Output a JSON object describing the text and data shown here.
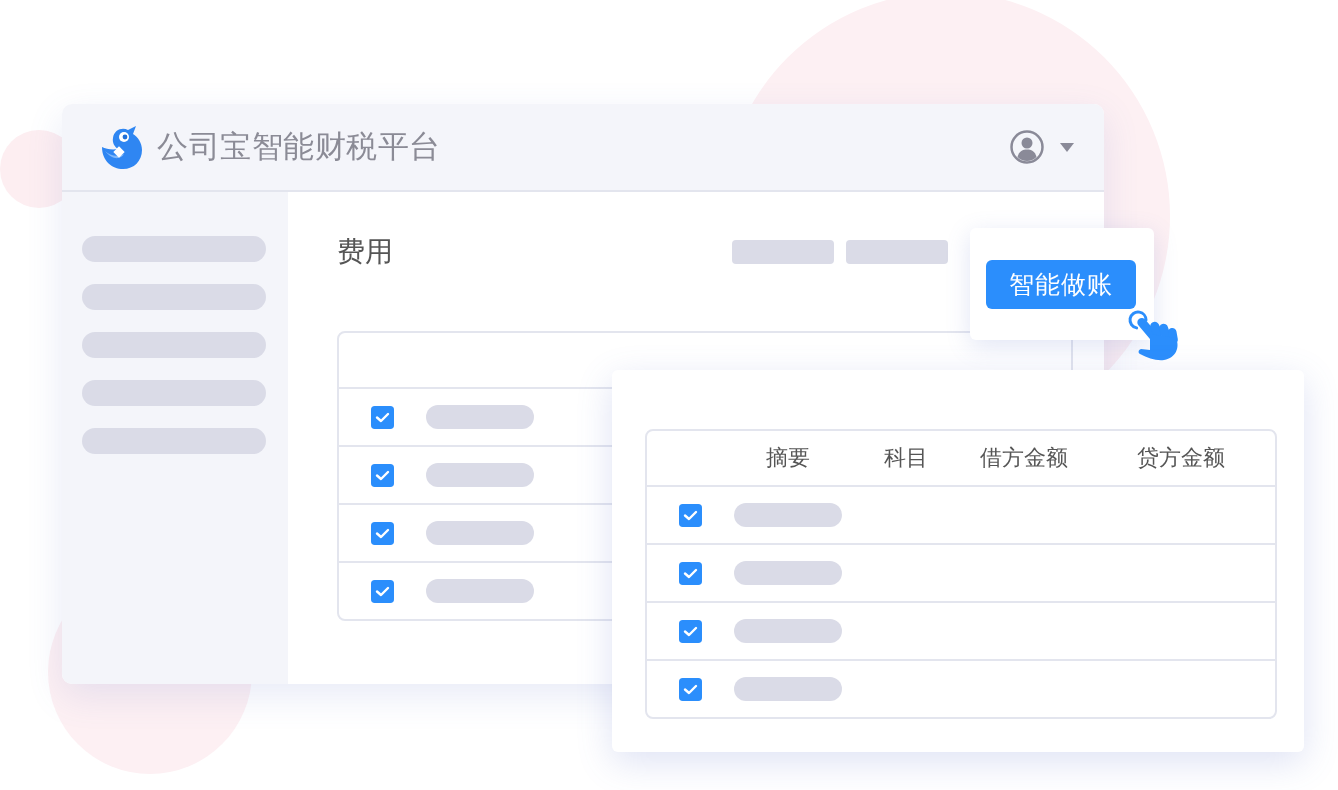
{
  "header": {
    "title": "公司宝智能财税平台"
  },
  "page": {
    "title": "费用"
  },
  "expense_table": {
    "rows": [
      {
        "checked": true
      },
      {
        "checked": true
      },
      {
        "checked": true
      },
      {
        "checked": true
      }
    ]
  },
  "action_button": {
    "label": "智能做账"
  },
  "voucher_table": {
    "columns": [
      "摘要",
      "科目",
      "借方金额",
      "贷方金额"
    ],
    "rows": [
      {
        "checked": true
      },
      {
        "checked": true
      },
      {
        "checked": true
      },
      {
        "checked": true
      }
    ]
  }
}
